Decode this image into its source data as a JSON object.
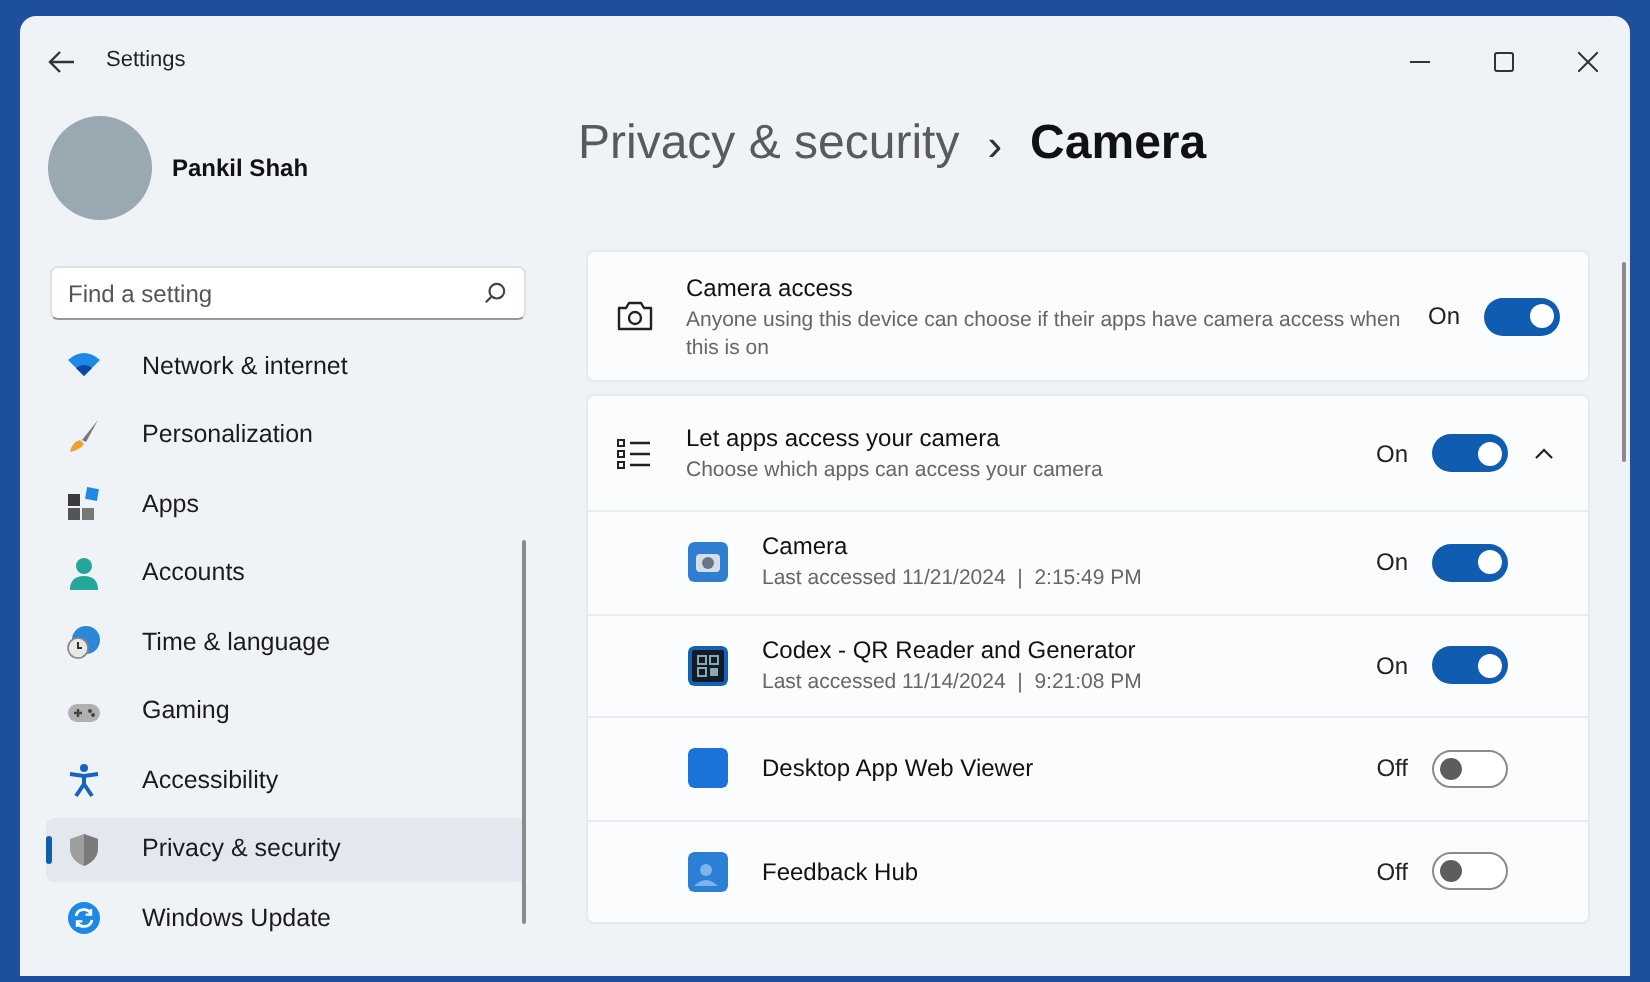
{
  "window": {
    "title": "Settings"
  },
  "profile": {
    "name": "Pankil Shah"
  },
  "search": {
    "placeholder": "Find a setting"
  },
  "sidebar": {
    "items": [
      {
        "label": "Network & internet",
        "kind": "wifi",
        "selected": false
      },
      {
        "label": "Personalization",
        "kind": "brush",
        "selected": false
      },
      {
        "label": "Apps",
        "kind": "apps",
        "selected": false
      },
      {
        "label": "Accounts",
        "kind": "person",
        "selected": false
      },
      {
        "label": "Time & language",
        "kind": "globe",
        "selected": false
      },
      {
        "label": "Gaming",
        "kind": "gamepad",
        "selected": false
      },
      {
        "label": "Accessibility",
        "kind": "accessibility",
        "selected": false
      },
      {
        "label": "Privacy & security",
        "kind": "shield",
        "selected": true
      },
      {
        "label": "Windows Update",
        "kind": "update",
        "selected": false
      }
    ]
  },
  "breadcrumb": {
    "parent": "Privacy & security",
    "separator": "›",
    "current": "Camera"
  },
  "camera_access": {
    "title": "Camera access",
    "description": "Anyone using this device can choose if their apps have camera access when this is on",
    "state_label": "On",
    "on": true
  },
  "app_access": {
    "title": "Let apps access your camera",
    "description": "Choose which apps can access your camera",
    "state_label": "On",
    "on": true,
    "expanded": true,
    "apps": [
      {
        "name": "Camera",
        "kind": "camera",
        "last_accessed": "Last accessed 11/21/2024  |  2:15:49 PM",
        "state_label": "On",
        "on": true
      },
      {
        "name": "Codex - QR Reader and Generator",
        "kind": "qr",
        "last_accessed": "Last accessed 11/14/2024  |  9:21:08 PM",
        "state_label": "On",
        "on": true
      },
      {
        "name": "Desktop App Web Viewer",
        "kind": "square",
        "state_label": "Off",
        "on": false
      },
      {
        "name": "Feedback Hub",
        "kind": "feedback",
        "state_label": "Off",
        "on": false
      }
    ]
  }
}
